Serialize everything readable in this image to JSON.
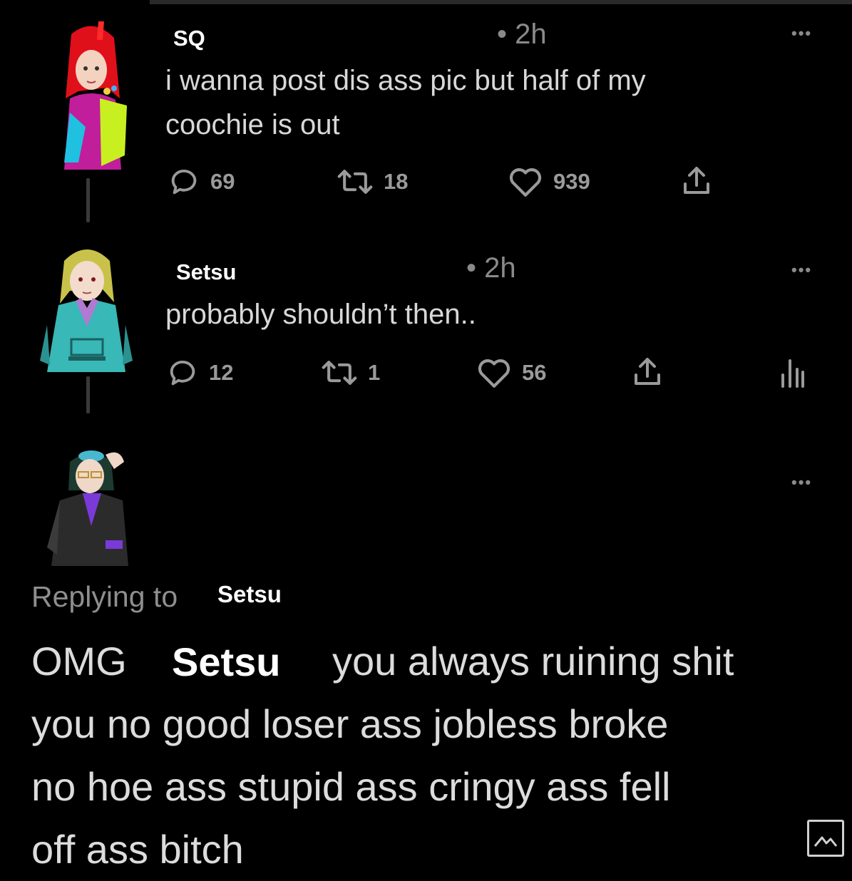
{
  "posts": [
    {
      "username": "SQ",
      "time": "• 2h",
      "more": "•••",
      "text_lines": [
        "i wanna post dis ass pic but half of my",
        "coochie is out"
      ],
      "replies": "69",
      "retweets": "18",
      "likes": "939",
      "avatar_icon": "red-haired-girl-avatar"
    },
    {
      "username": "Setsu",
      "time": "• 2h",
      "more": "•••",
      "text_lines": [
        "probably shouldn’t then.."
      ],
      "replies": "12",
      "retweets": "1",
      "likes": "56",
      "avatar_icon": "blonde-jacket-avatar"
    }
  ],
  "reply": {
    "more": "•••",
    "avatar_icon": "goggles-jacket-avatar",
    "replying_label": "Replying to",
    "replying_name": "Setsu",
    "line1_prefix": "OMG",
    "line1_name": "Setsu",
    "line1_suffix": "you always ruining shit",
    "line2": "you no good loser ass jobless broke",
    "line3": "no hoe ass stupid ass cringy ass fell",
    "line4": "off ass bitch"
  },
  "colors": {
    "background": "#000000",
    "text": "#d8d8d8",
    "muted": "#8a8a8a",
    "username": "#ffffff"
  }
}
